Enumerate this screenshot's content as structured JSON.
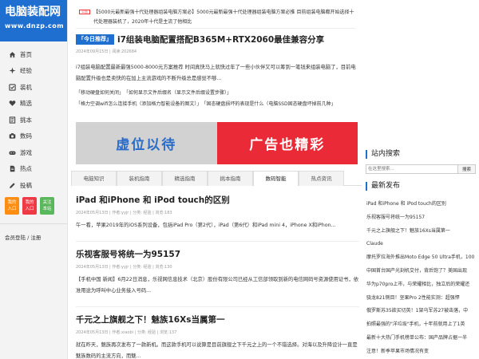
{
  "logo": {
    "name": "电脑装配网",
    "url_text": "www.dnzp.com"
  },
  "nav": [
    {
      "label": "首页",
      "icon": "home-icon"
    },
    {
      "label": "经验",
      "icon": "sparkle-icon"
    },
    {
      "label": "装机",
      "icon": "checkbox-icon"
    },
    {
      "label": "精选",
      "icon": "heart-icon"
    },
    {
      "label": "挑本",
      "icon": "book-icon"
    },
    {
      "label": "数码",
      "icon": "camera-icon"
    },
    {
      "label": "游戏",
      "icon": "gamepad-icon"
    },
    {
      "label": "热点",
      "icon": "document-icon"
    },
    {
      "label": "投稿",
      "icon": "pencil-icon"
    }
  ],
  "side_buttons": [
    {
      "line1": "我的",
      "line2": "入口",
      "color": "#ff8d12"
    },
    {
      "line1": "我的",
      "line2": "入口",
      "color": "#ee3a44"
    },
    {
      "line1": "关注",
      "line2": "本站",
      "color": "#5bb75b"
    }
  ],
  "member_login": "会员登陆 / 注册",
  "notice": {
    "badge": "公告",
    "text": "【5000元最新最强十代处理器组装电脑方案必】5000元最新最强十代处理器组装电脑方案必推 目前组装电脑都开始选择十代处理器装机了，2020年十代是主流了他相比"
  },
  "recommend": {
    "badge": "「今日推荐」",
    "title": "i7组装电脑配置搭配B365M+RTX2060最佳兼容分享",
    "meta": "2024年09月15日 | 阅读:202684",
    "summary": "i7组装电脑配置最新最强5000-8000元方案推荐 时间真快马上就快过年了一些小伙伴又可以筹到一笔钱来组装电脑了，目前电脑配置升级也是卖快的在加上主流游戏的不断升级总是感觉不够...",
    "links": [
      [
        "「移动硬盘如何关闭」",
        "「如何显示文件后缀名（显示文件后缀设置步骤）」"
      ],
      [
        "「格力空调wifi怎么连接手机（添加格力智能设备的图文）」",
        "「固态硬盘损坏的表现是什么（电脑SSD固态硬盘坏掉前几种」"
      ]
    ]
  },
  "banner": {
    "left_text": "虚位以待",
    "right_text": "广告也精彩"
  },
  "tabs": [
    {
      "label": "电脑知识",
      "active": false
    },
    {
      "label": "装机指南",
      "active": false
    },
    {
      "label": "精选指南",
      "active": false
    },
    {
      "label": "挑本指南",
      "active": false
    },
    {
      "label": "数码智能",
      "active": true
    },
    {
      "label": "热点资讯",
      "active": false
    }
  ],
  "articles": [
    {
      "title": "iPad 和iPhone 和 iPod touch的区别",
      "meta": "2024年05月13日 | 作者:yyjr | 分类: 经验 | 浏览:183",
      "summary": "午一看，苹果2019年的iOS系列设备，包括iPad Pro（第2代），iPad（第6代）和iPad mini 4，iPhone X和iPhon..."
    },
    {
      "title": "乐视客服号将统一为95157",
      "meta": "2024年05月13日 | 作者:yyjr | 分类: 经验 | 浏览:130",
      "summary": "【手机中国 新闻】6月22日消息，乐视网信息技术（北京）股份有限公司已经从工信部领取到新的电信网码号资源使用证书，依准用途为呼叫中心业务接入号码..."
    },
    {
      "title": "千元之上旗舰之下！魅族16Xs当属第一",
      "meta": "2024年05月13日 | 作者:xiaobi | 分类: 经验 | 浏览:137",
      "summary": "就在昨天，魅族再次发布了一款新机。而这款手机可以说算是目前旗舰之下千元之上的一个不错选择。对海以及升降设计一直是魅族数码的主流方向，而魅..."
    }
  ],
  "right": {
    "search_title": "站内搜索",
    "search_placeholder": "在这里搜索...",
    "search_button": "搜索",
    "latest_title": "最新发布",
    "latest": [
      "iPad 和iPhone 和 iPod touch的区别",
      "乐视客服号将统一为95157",
      "千元之上旗舰之下！魅族16Xs当属第一",
      "Claude",
      "摩托罗拉海外推出Moto Edge 50 Ultra手机，100",
      "中国首台国产光刻机交付，背后饱了？美国出现",
      "华为p70pro上市，与荣耀相比，独立后的荣耀还",
      "骁龙821侧目！坚果Pro 2性能实测：超强悍",
      "俄罗斯苏35欲买切英！1架乌军苏27被击落，中",
      "拍照最强的\"洋垃圾\"手机，十年前就用上了1英",
      "最新十大热门手机榜单公布：国产品牌占据一半",
      "注意！新季苹果市场情况有变"
    ]
  },
  "colors": {
    "brand": "#1e6fcf",
    "orange": "#ff8d12",
    "red": "#ee3a44",
    "green": "#5bb75b",
    "banner_red": "#ea2a36"
  }
}
